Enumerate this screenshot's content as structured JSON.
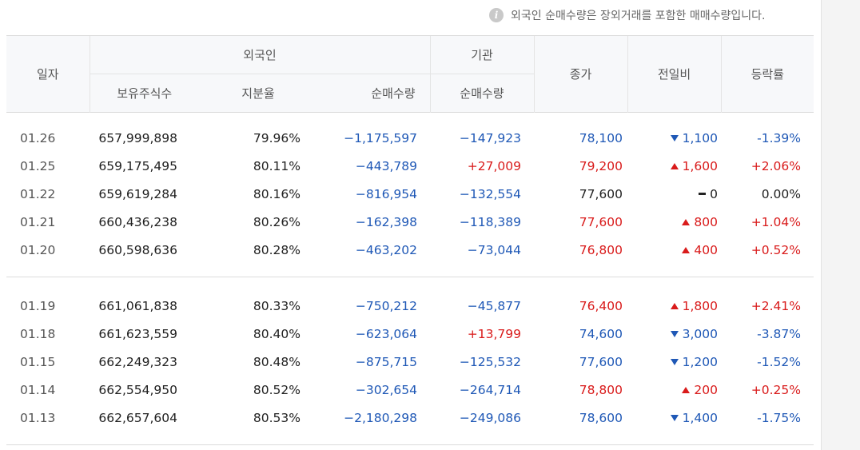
{
  "notice": {
    "icon": "info-icon",
    "text": "외국인 순매수량은 장외거래를 포함한 매매수량입니다."
  },
  "headers": {
    "date": "일자",
    "foreign": "외국인",
    "institution": "기관",
    "close": "종가",
    "change": "전일비",
    "rate": "등락률",
    "holdings": "보유주식수",
    "share": "지분율",
    "foreign_net": "순매수량",
    "inst_net": "순매수량"
  },
  "groups": [
    {
      "rows": [
        {
          "date": "01.26",
          "holdings": "657,999,898",
          "share": "79.96%",
          "foreign_net": "−1,175,597",
          "foreign_dir": "down",
          "inst_net": "−147,923",
          "inst_dir": "down",
          "close": "78,100",
          "dir": "down",
          "change": "1,100",
          "rate": "-1.39%"
        },
        {
          "date": "01.25",
          "holdings": "659,175,495",
          "share": "80.11%",
          "foreign_net": "−443,789",
          "foreign_dir": "down",
          "inst_net": "+27,009",
          "inst_dir": "up",
          "close": "79,200",
          "dir": "up",
          "change": "1,600",
          "rate": "+2.06%"
        },
        {
          "date": "01.22",
          "holdings": "659,619,284",
          "share": "80.16%",
          "foreign_net": "−816,954",
          "foreign_dir": "down",
          "inst_net": "−132,554",
          "inst_dir": "down",
          "close": "77,600",
          "dir": "flat",
          "change": "0",
          "rate": "0.00%"
        },
        {
          "date": "01.21",
          "holdings": "660,436,238",
          "share": "80.26%",
          "foreign_net": "−162,398",
          "foreign_dir": "down",
          "inst_net": "−118,389",
          "inst_dir": "down",
          "close": "77,600",
          "dir": "up",
          "change": "800",
          "rate": "+1.04%"
        },
        {
          "date": "01.20",
          "holdings": "660,598,636",
          "share": "80.28%",
          "foreign_net": "−463,202",
          "foreign_dir": "down",
          "inst_net": "−73,044",
          "inst_dir": "down",
          "close": "76,800",
          "dir": "up",
          "change": "400",
          "rate": "+0.52%"
        }
      ]
    },
    {
      "rows": [
        {
          "date": "01.19",
          "holdings": "661,061,838",
          "share": "80.33%",
          "foreign_net": "−750,212",
          "foreign_dir": "down",
          "inst_net": "−45,877",
          "inst_dir": "down",
          "close": "76,400",
          "dir": "up",
          "change": "1,800",
          "rate": "+2.41%"
        },
        {
          "date": "01.18",
          "holdings": "661,623,559",
          "share": "80.40%",
          "foreign_net": "−623,064",
          "foreign_dir": "down",
          "inst_net": "+13,799",
          "inst_dir": "up",
          "close": "74,600",
          "dir": "down",
          "change": "3,000",
          "rate": "-3.87%"
        },
        {
          "date": "01.15",
          "holdings": "662,249,323",
          "share": "80.48%",
          "foreign_net": "−875,715",
          "foreign_dir": "down",
          "inst_net": "−125,532",
          "inst_dir": "down",
          "close": "77,600",
          "dir": "down",
          "change": "1,200",
          "rate": "-1.52%"
        },
        {
          "date": "01.14",
          "holdings": "662,554,950",
          "share": "80.52%",
          "foreign_net": "−302,654",
          "foreign_dir": "down",
          "inst_net": "−264,714",
          "inst_dir": "down",
          "close": "78,800",
          "dir": "up",
          "change": "200",
          "rate": "+0.25%"
        },
        {
          "date": "01.13",
          "holdings": "662,657,604",
          "share": "80.53%",
          "foreign_net": "−2,180,298",
          "foreign_dir": "down",
          "inst_net": "−249,086",
          "inst_dir": "down",
          "close": "78,600",
          "dir": "down",
          "change": "1,400",
          "rate": "-1.75%"
        }
      ]
    }
  ],
  "colors": {
    "up": "#d91b1b",
    "down": "#1f58b6",
    "flat": "#222222",
    "header_bg": "#f7f8fa"
  }
}
